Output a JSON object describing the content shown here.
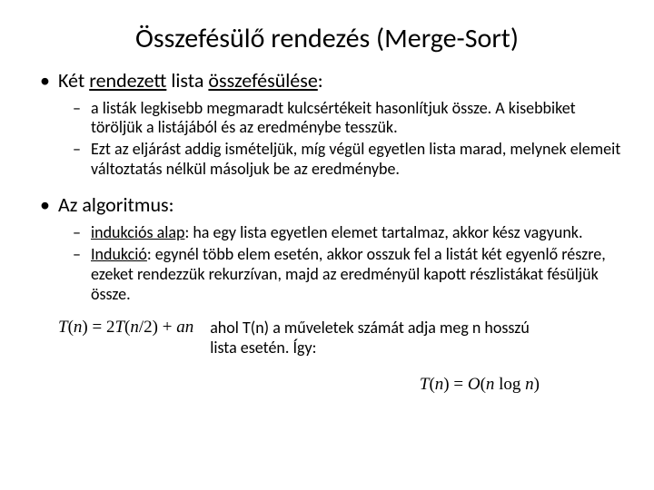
{
  "title": "Összefésülő rendezés (Merge-Sort)",
  "b1": {
    "head_a": "Két ",
    "head_u": "rendezett",
    "head_b": " lista ",
    "head_u2": "összefésülése",
    "head_c": ":",
    "s1": "a listák legkisebb megmaradt kulcsértékeit hasonlítjuk össze. A kisebbiket töröljük a listájából és az eredménybe tesszük.",
    "s2": "Ezt az eljárást addig ismételjük, míg végül egyetlen lista marad, melynek elemeit változtatás nélkül másoljuk be az eredménybe."
  },
  "b2": {
    "head": "Az algoritmus:",
    "s1_u": "indukciós alap",
    "s1_rest": ": ha egy lista egyetlen elemet tartalmaz, akkor kész vagyunk.",
    "s2_u": "Indukció",
    "s2_rest": ": egynél több elem esetén, akkor osszuk fel a listát két egyenlő részre, ezeket rendezzük rekurzívan, majd az eredményül kapott részlistákat fésüljük össze."
  },
  "eq1": {
    "lhs_T": "T",
    "lhs_open": "(",
    "lhs_n": "n",
    "lhs_close": ") = 2",
    "rhs_T": "T",
    "rhs_open": "(",
    "rhs_n": "n",
    "rhs_div": "/2) + ",
    "rhs_a": "an"
  },
  "eq_note_a": "ahol ",
  "eq_note_Tn": "T(n)",
  "eq_note_b": " a műveletek számát adja meg ",
  "eq_note_n": "n",
  "eq_note_c": " hosszú lista esetén. Így:",
  "eq2": {
    "T": "T",
    "open": "(",
    "n1": "n",
    "mid": ") = ",
    "O": "O",
    "open2": "(",
    "n2": "n",
    "log": " log ",
    "n3": "n",
    "close": ")"
  }
}
